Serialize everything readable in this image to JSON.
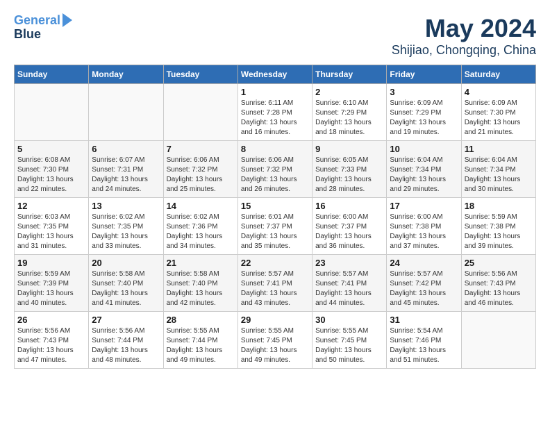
{
  "logo": {
    "line1": "General",
    "line2": "Blue"
  },
  "title": "May 2024",
  "subtitle": "Shijiao, Chongqing, China",
  "headers": [
    "Sunday",
    "Monday",
    "Tuesday",
    "Wednesday",
    "Thursday",
    "Friday",
    "Saturday"
  ],
  "weeks": [
    [
      {
        "day": "",
        "info": ""
      },
      {
        "day": "",
        "info": ""
      },
      {
        "day": "",
        "info": ""
      },
      {
        "day": "1",
        "info": "Sunrise: 6:11 AM\nSunset: 7:28 PM\nDaylight: 13 hours\nand 16 minutes."
      },
      {
        "day": "2",
        "info": "Sunrise: 6:10 AM\nSunset: 7:29 PM\nDaylight: 13 hours\nand 18 minutes."
      },
      {
        "day": "3",
        "info": "Sunrise: 6:09 AM\nSunset: 7:29 PM\nDaylight: 13 hours\nand 19 minutes."
      },
      {
        "day": "4",
        "info": "Sunrise: 6:09 AM\nSunset: 7:30 PM\nDaylight: 13 hours\nand 21 minutes."
      }
    ],
    [
      {
        "day": "5",
        "info": "Sunrise: 6:08 AM\nSunset: 7:30 PM\nDaylight: 13 hours\nand 22 minutes."
      },
      {
        "day": "6",
        "info": "Sunrise: 6:07 AM\nSunset: 7:31 PM\nDaylight: 13 hours\nand 24 minutes."
      },
      {
        "day": "7",
        "info": "Sunrise: 6:06 AM\nSunset: 7:32 PM\nDaylight: 13 hours\nand 25 minutes."
      },
      {
        "day": "8",
        "info": "Sunrise: 6:06 AM\nSunset: 7:32 PM\nDaylight: 13 hours\nand 26 minutes."
      },
      {
        "day": "9",
        "info": "Sunrise: 6:05 AM\nSunset: 7:33 PM\nDaylight: 13 hours\nand 28 minutes."
      },
      {
        "day": "10",
        "info": "Sunrise: 6:04 AM\nSunset: 7:34 PM\nDaylight: 13 hours\nand 29 minutes."
      },
      {
        "day": "11",
        "info": "Sunrise: 6:04 AM\nSunset: 7:34 PM\nDaylight: 13 hours\nand 30 minutes."
      }
    ],
    [
      {
        "day": "12",
        "info": "Sunrise: 6:03 AM\nSunset: 7:35 PM\nDaylight: 13 hours\nand 31 minutes."
      },
      {
        "day": "13",
        "info": "Sunrise: 6:02 AM\nSunset: 7:35 PM\nDaylight: 13 hours\nand 33 minutes."
      },
      {
        "day": "14",
        "info": "Sunrise: 6:02 AM\nSunset: 7:36 PM\nDaylight: 13 hours\nand 34 minutes."
      },
      {
        "day": "15",
        "info": "Sunrise: 6:01 AM\nSunset: 7:37 PM\nDaylight: 13 hours\nand 35 minutes."
      },
      {
        "day": "16",
        "info": "Sunrise: 6:00 AM\nSunset: 7:37 PM\nDaylight: 13 hours\nand 36 minutes."
      },
      {
        "day": "17",
        "info": "Sunrise: 6:00 AM\nSunset: 7:38 PM\nDaylight: 13 hours\nand 37 minutes."
      },
      {
        "day": "18",
        "info": "Sunrise: 5:59 AM\nSunset: 7:38 PM\nDaylight: 13 hours\nand 39 minutes."
      }
    ],
    [
      {
        "day": "19",
        "info": "Sunrise: 5:59 AM\nSunset: 7:39 PM\nDaylight: 13 hours\nand 40 minutes."
      },
      {
        "day": "20",
        "info": "Sunrise: 5:58 AM\nSunset: 7:40 PM\nDaylight: 13 hours\nand 41 minutes."
      },
      {
        "day": "21",
        "info": "Sunrise: 5:58 AM\nSunset: 7:40 PM\nDaylight: 13 hours\nand 42 minutes."
      },
      {
        "day": "22",
        "info": "Sunrise: 5:57 AM\nSunset: 7:41 PM\nDaylight: 13 hours\nand 43 minutes."
      },
      {
        "day": "23",
        "info": "Sunrise: 5:57 AM\nSunset: 7:41 PM\nDaylight: 13 hours\nand 44 minutes."
      },
      {
        "day": "24",
        "info": "Sunrise: 5:57 AM\nSunset: 7:42 PM\nDaylight: 13 hours\nand 45 minutes."
      },
      {
        "day": "25",
        "info": "Sunrise: 5:56 AM\nSunset: 7:43 PM\nDaylight: 13 hours\nand 46 minutes."
      }
    ],
    [
      {
        "day": "26",
        "info": "Sunrise: 5:56 AM\nSunset: 7:43 PM\nDaylight: 13 hours\nand 47 minutes."
      },
      {
        "day": "27",
        "info": "Sunrise: 5:56 AM\nSunset: 7:44 PM\nDaylight: 13 hours\nand 48 minutes."
      },
      {
        "day": "28",
        "info": "Sunrise: 5:55 AM\nSunset: 7:44 PM\nDaylight: 13 hours\nand 49 minutes."
      },
      {
        "day": "29",
        "info": "Sunrise: 5:55 AM\nSunset: 7:45 PM\nDaylight: 13 hours\nand 49 minutes."
      },
      {
        "day": "30",
        "info": "Sunrise: 5:55 AM\nSunset: 7:45 PM\nDaylight: 13 hours\nand 50 minutes."
      },
      {
        "day": "31",
        "info": "Sunrise: 5:54 AM\nSunset: 7:46 PM\nDaylight: 13 hours\nand 51 minutes."
      },
      {
        "day": "",
        "info": ""
      }
    ]
  ]
}
